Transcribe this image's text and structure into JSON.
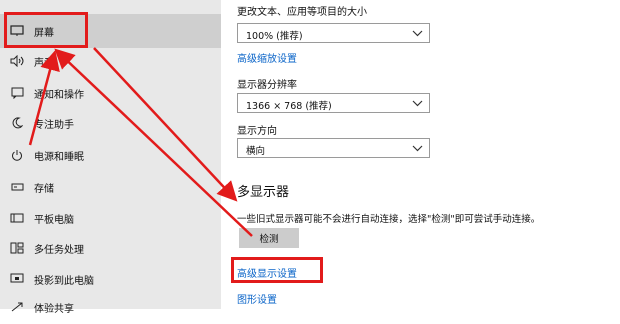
{
  "sidebar": {
    "items": [
      {
        "icon": "monitor-icon",
        "label": "屏幕"
      },
      {
        "icon": "speaker-icon",
        "label": "声音"
      },
      {
        "icon": "notification-icon",
        "label": "通知和操作"
      },
      {
        "icon": "moon-icon",
        "label": "专注助手"
      },
      {
        "icon": "power-icon",
        "label": "电源和睡眠"
      },
      {
        "icon": "storage-icon",
        "label": "存储"
      },
      {
        "icon": "tablet-icon",
        "label": "平板电脑"
      },
      {
        "icon": "multitask-icon",
        "label": "多任务处理"
      },
      {
        "icon": "project-icon",
        "label": "投影到此电脑"
      },
      {
        "icon": "shared-icon",
        "label": "体验共享"
      }
    ]
  },
  "display": {
    "scale_label": "更改文本、应用等项目的大小",
    "scale_value": "100% (推荐)",
    "advanced_scale_link": "高级缩放设置",
    "resolution_label": "显示器分辨率",
    "resolution_value": "1366 × 768 (推荐)",
    "orientation_label": "显示方向",
    "orientation_value": "横向",
    "multi_title": "多显示器",
    "multi_note": "一些旧式显示器可能不会进行自动连接，选择\"检测\"即可尝试手动连接。",
    "detect_button": "检测",
    "advanced_display_link": "高级显示设置",
    "graphics_link": "图形设置"
  },
  "colors": {
    "annotation_red": "#e21b1b",
    "link_blue": "#0a64c8"
  }
}
